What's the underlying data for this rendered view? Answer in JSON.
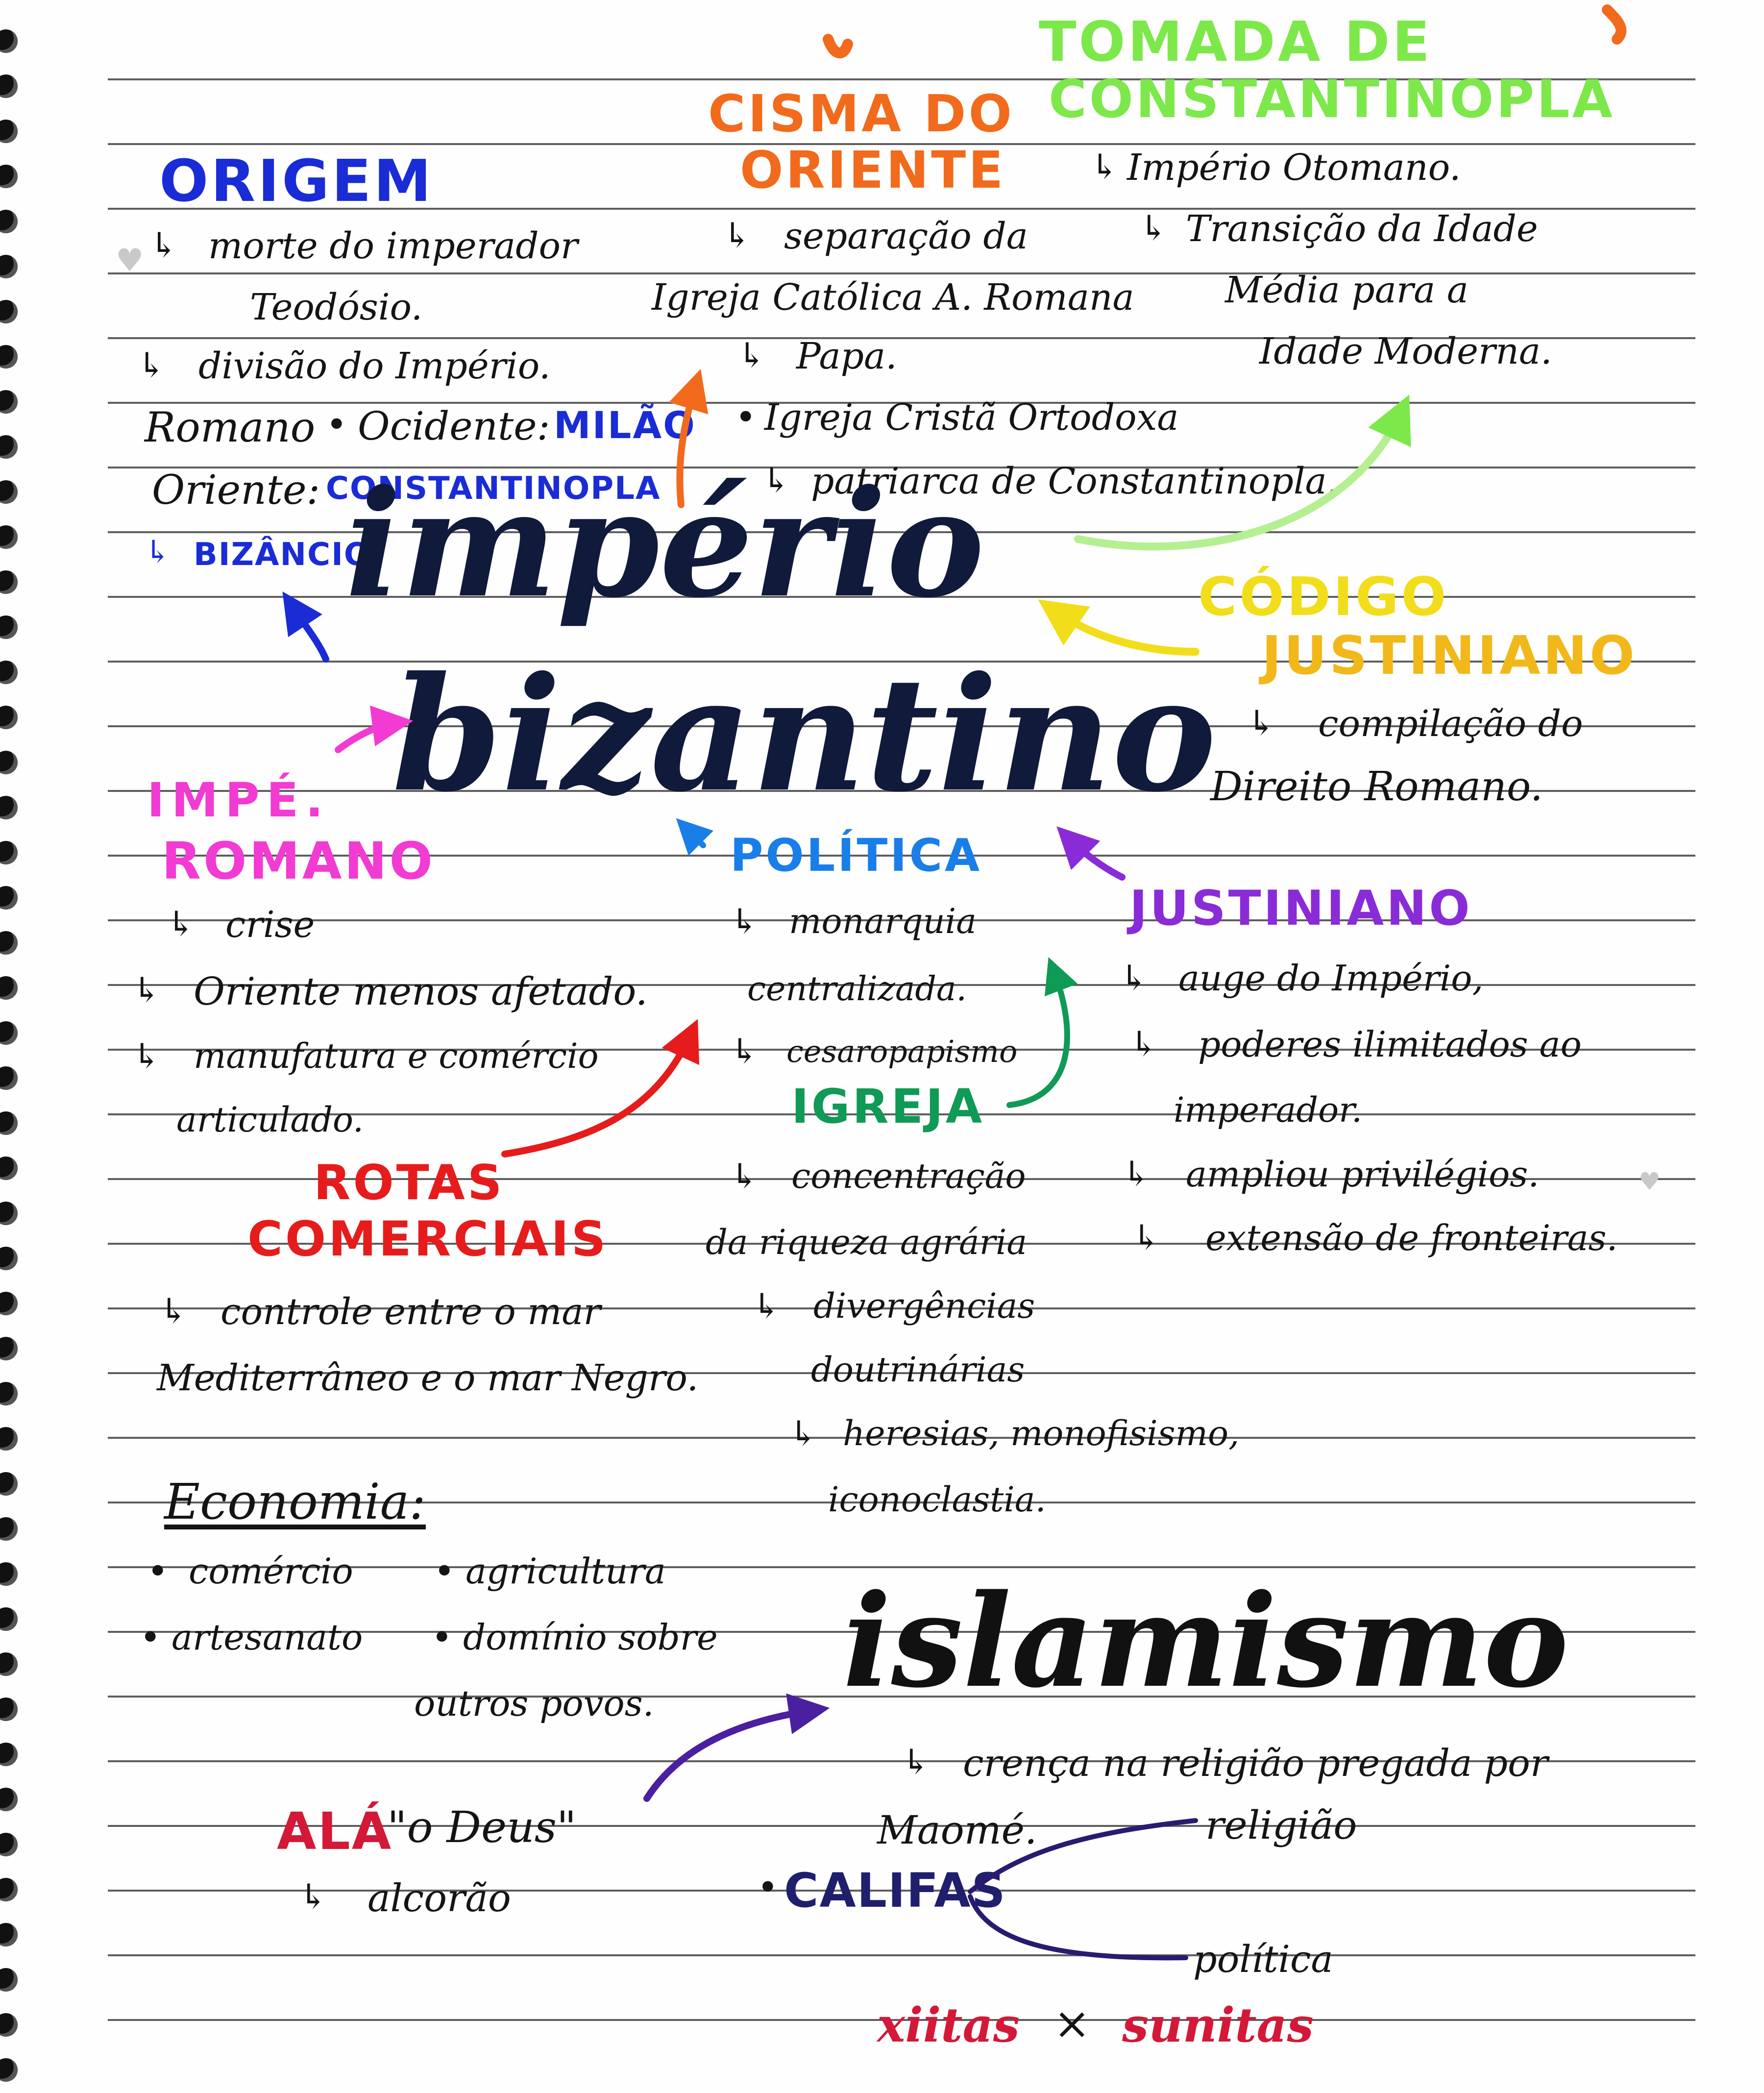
{
  "colors": {
    "ink": "#141414",
    "navy": "#101a3a",
    "blue": "#1a2cd6",
    "orange": "#f26a1c",
    "green": "#7de84a",
    "yellow": "#f2dd1a",
    "magenta": "#f23bd2",
    "purple": "#8a2bd8",
    "red": "#e61c1c",
    "teal": "#0f9a55",
    "violet": "#4a1fa0",
    "crimson": "#d41838"
  },
  "main_title": {
    "line1": "império",
    "line2": "bizantino"
  },
  "tomada": {
    "title1": "TOMADA DE",
    "title2": "CONSTANTINOPLA",
    "bullet1": "Império Otomano.",
    "bullet2": "Transição da Idade",
    "bullet2_cont1": "Média para a",
    "bullet2_cont2": "Idade Moderna."
  },
  "cisma": {
    "title1": "CISMA DO",
    "title2": "ORIENTE",
    "line1": "separação da",
    "line2": "Igreja Católica A. Romana",
    "line3": "Papa.",
    "line4": "Igreja Cristã Ortodoxa",
    "line5": "patriarca de Constantinopla."
  },
  "origem": {
    "title": "ORIGEM",
    "line1": "morte do imperador",
    "line2": "Teodósio.",
    "line3": "divisão do Império.",
    "romano": "Romano",
    "ocidente": "Ocidente:",
    "milao": "MILÃO",
    "oriente": "Oriente:",
    "constantinopla": "CONSTANTINOPLA",
    "bizancio": "BIZÂNCIO"
  },
  "codigo": {
    "title1": "CÓDIGO",
    "title2": "JUSTINIANO",
    "line1": "compilação do",
    "line2": "Direito Romano."
  },
  "impe_romano": {
    "title1": "IMPÉ.",
    "title2": "ROMANO",
    "line1": "crise",
    "line2": "Oriente menos afetado.",
    "line3": "manufatura e comércio",
    "line4": "articulado."
  },
  "politica": {
    "title": "POLÍTICA",
    "line1": "monarquia",
    "line2": "centralizada.",
    "line3": "cesaropapismo"
  },
  "igreja": {
    "title": "IGREJA",
    "line1": "concentração",
    "line2": "da riqueza agrária",
    "line3": "divergências",
    "line4": "doutrinárias",
    "line5": "heresias, monofisismo,",
    "line6": "iconoclastia."
  },
  "justiniano": {
    "title": "JUSTINIANO",
    "line1": "auge do Império,",
    "line2": "poderes ilimitados ao",
    "line3": "imperador.",
    "line4": "ampliou privilégios.",
    "line5": "extensão de fronteiras."
  },
  "rotas": {
    "title1": "ROTAS",
    "title2": "COMERCIAIS",
    "line1": "controle entre o mar",
    "line2": "Mediterrâneo e o mar Negro."
  },
  "economia": {
    "title": "Economia:",
    "item1": "comércio",
    "item2": "agricultura",
    "item3": "artesanato",
    "item4": "domínio sobre",
    "item4_cont": "outros povos."
  },
  "islamismo": {
    "title": "islamismo",
    "line1": "crença na religião pregada por",
    "line2": "Maomé.",
    "ala": "ALÁ",
    "ala_quote": "\"o Deus\"",
    "alcorao": "alcorão",
    "califas": "CALIFAS",
    "religiao": "religião",
    "politica": "política",
    "xiitas": "xiitas",
    "vs": "×",
    "sunitas": "sunitas"
  },
  "glyphs": {
    "arrow": "↳",
    "bullet": "•",
    "heart": "♥"
  }
}
